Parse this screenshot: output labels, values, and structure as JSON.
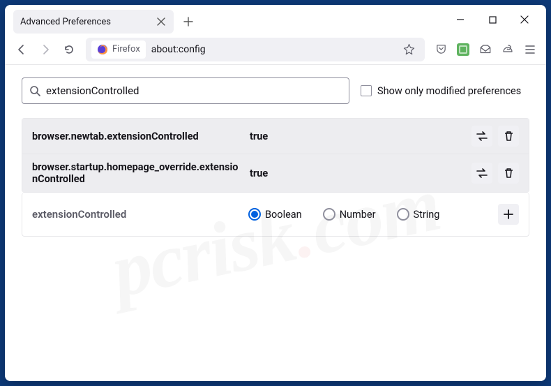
{
  "tab": {
    "title": "Advanced Preferences"
  },
  "urlbar": {
    "identity": "Firefox",
    "url": "about:config"
  },
  "search": {
    "value": "extensionControlled"
  },
  "filter": {
    "label": "Show only modified preferences"
  },
  "prefs": [
    {
      "name": "browser.newtab.extensionControlled",
      "value": "true"
    },
    {
      "name": "browser.startup.homepage_override.extensionControlled",
      "value": "true"
    }
  ],
  "newpref": {
    "name": "extensionControlled",
    "types": [
      {
        "label": "Boolean",
        "checked": true
      },
      {
        "label": "Number",
        "checked": false
      },
      {
        "label": "String",
        "checked": false
      }
    ]
  }
}
